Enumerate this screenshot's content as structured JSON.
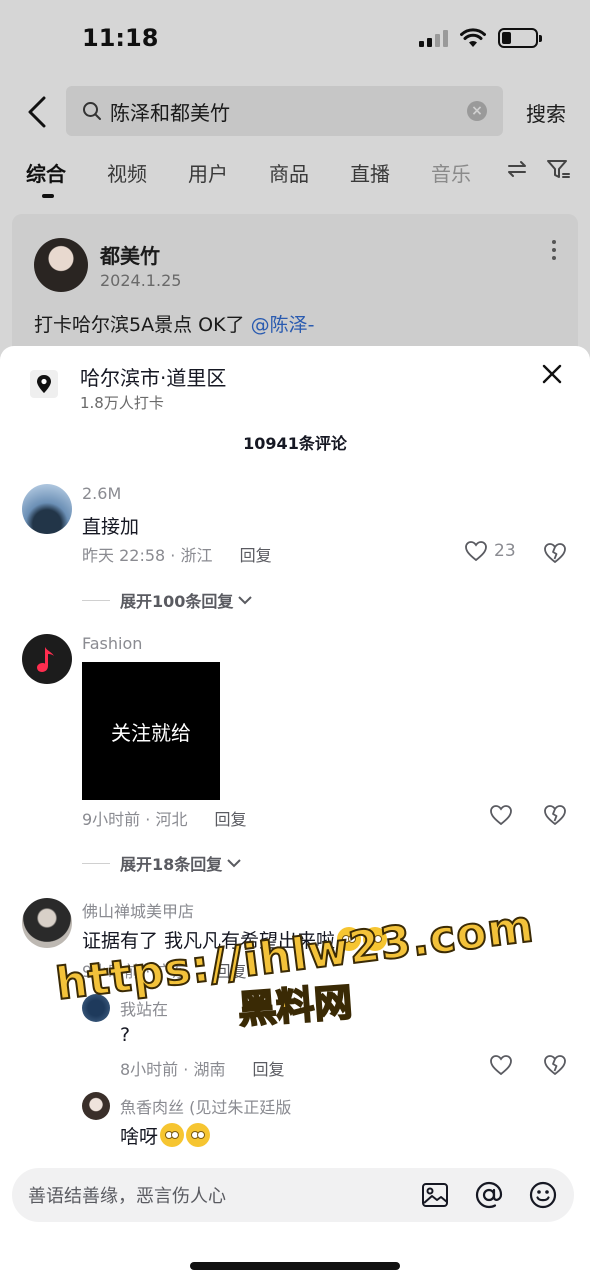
{
  "status_bar": {
    "time": "11:18"
  },
  "search": {
    "query": "陈泽和都美竹",
    "button": "搜索"
  },
  "tabs": [
    {
      "label": "综合"
    },
    {
      "label": "视频"
    },
    {
      "label": "用户"
    },
    {
      "label": "商品"
    },
    {
      "label": "直播"
    },
    {
      "label": "音乐"
    }
  ],
  "post": {
    "author": "都美竹",
    "date": "2024.1.25",
    "text": "打卡哈尔滨5A景点 OK了",
    "mention": "@陈泽-"
  },
  "sheet": {
    "location": "哈尔滨市·道里区",
    "checkins": "1.8万人打卡",
    "comment_count": "10941条评论"
  },
  "comments": [
    {
      "user": "2.6M",
      "text": "直接加",
      "meta": "昨天 22:58 · 浙江",
      "reply": "回复",
      "likes": "23",
      "expand": "展开100条回复"
    },
    {
      "user": "Fashion",
      "image_text": "关注就给",
      "meta": "9小时前 · 河北",
      "reply": "回复",
      "expand": "展开18条回复"
    },
    {
      "user": "佛山禅城美甲店",
      "text": "证据有了 我凡凡有希望出来啦",
      "meta": "9小时前 · 广东",
      "reply": "回复"
    }
  ],
  "replies": [
    {
      "user": "我站在",
      "text": "?",
      "meta": "8小时前 · 湖南",
      "reply": "回复"
    },
    {
      "user": "魚香肉丝 (见过朱正廷版",
      "text": "啥呀"
    }
  ],
  "watermark": {
    "url": "https://ihlw23.com",
    "name": "黑料网"
  },
  "input": {
    "placeholder": "善语结善缘，恶言伤人心"
  }
}
